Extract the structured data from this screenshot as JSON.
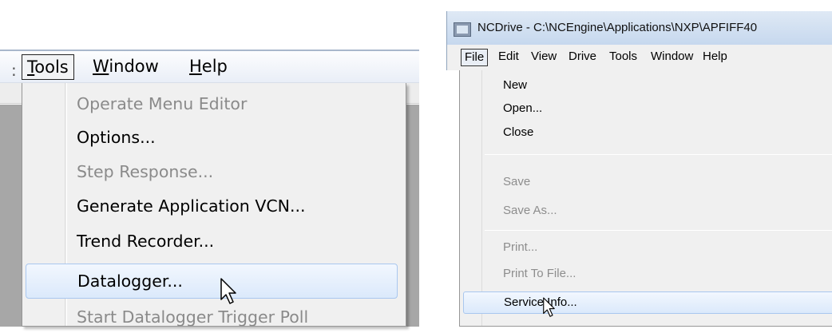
{
  "left": {
    "menubar": {
      "separator": ":",
      "items": [
        {
          "prefix": "",
          "underline": "T",
          "rest": "ools",
          "open": true
        },
        {
          "prefix": "",
          "underline": "W",
          "rest": "indow",
          "open": false
        },
        {
          "prefix": "",
          "underline": "H",
          "rest": "elp",
          "open": false
        }
      ]
    },
    "tools_menu": {
      "items": [
        {
          "label": "Operate Menu Editor",
          "enabled": false
        },
        {
          "label": "Options...",
          "enabled": true
        },
        {
          "label": "Step Response...",
          "enabled": false
        },
        {
          "label": "Generate Application VCN...",
          "enabled": true
        },
        {
          "label": "Trend Recorder...",
          "enabled": true
        },
        {
          "label": "Datalogger...",
          "enabled": true,
          "highlighted": true
        },
        {
          "label": "Start Datalogger Trigger Poll",
          "enabled": false
        }
      ]
    }
  },
  "right": {
    "window_title": "NCDrive - C:\\NCEngine\\Applications\\NXP\\APFIFF40",
    "menubar": {
      "items": [
        "File",
        "Edit",
        "View",
        "Drive",
        "Tools",
        "Window",
        "Help"
      ],
      "open_index": 0
    },
    "file_menu": {
      "items": [
        {
          "label": "New",
          "enabled": true
        },
        {
          "label": "Open...",
          "enabled": true
        },
        {
          "label": "Close",
          "enabled": true
        },
        {
          "separator": true
        },
        {
          "label": "Save",
          "enabled": false
        },
        {
          "label": "Save As...",
          "enabled": false
        },
        {
          "separator": true
        },
        {
          "label": "Print...",
          "enabled": false
        },
        {
          "label": "Print To File...",
          "enabled": false
        },
        {
          "label": "Service Info...",
          "enabled": true,
          "highlighted": true
        }
      ]
    }
  },
  "colors": {
    "menu_bg": "#f0f0f0",
    "highlight_bg": "#dbe9fb",
    "highlight_border": "#a9c7ef",
    "disabled_text": "#8a8a8a",
    "titlebar_bg": "#c6d8ee"
  }
}
